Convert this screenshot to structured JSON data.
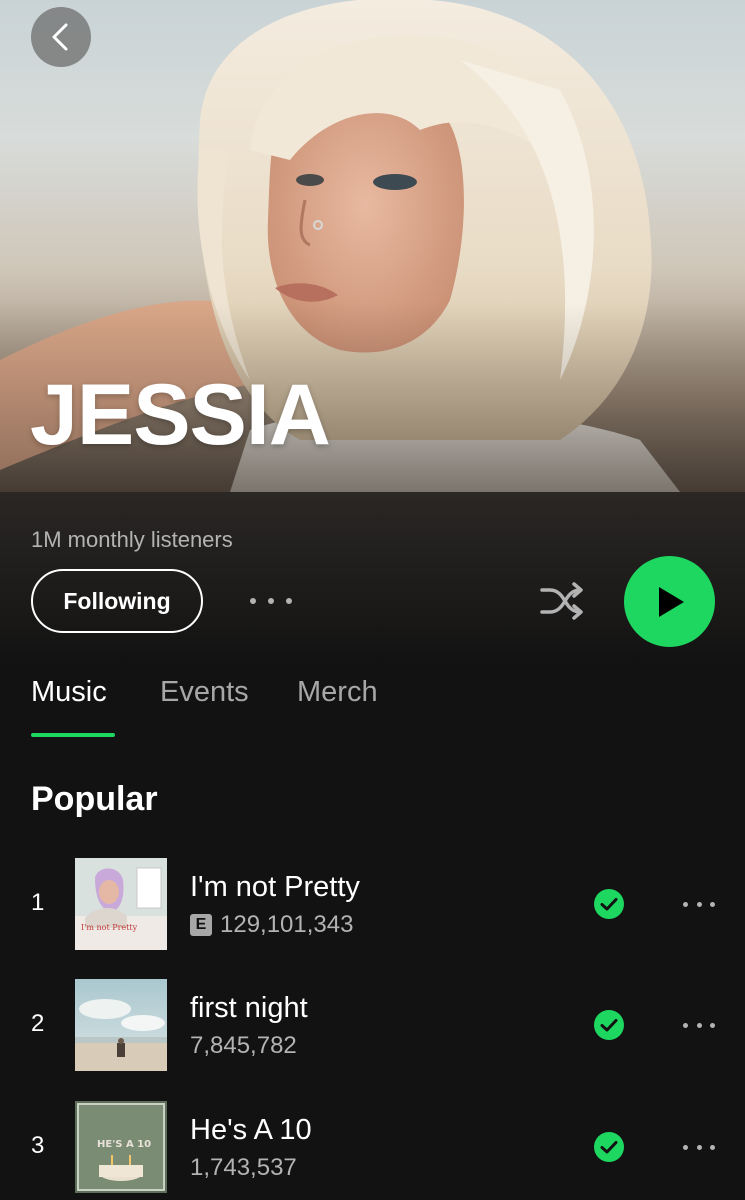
{
  "artist": {
    "name": "JESSIA",
    "monthly_listeners": "1M monthly listeners",
    "follow_label": "Following"
  },
  "tabs": [
    {
      "label": "Music",
      "active": true
    },
    {
      "label": "Events",
      "active": false
    },
    {
      "label": "Merch",
      "active": false
    }
  ],
  "popular": {
    "title": "Popular",
    "tracks": [
      {
        "rank": "1",
        "title": "I'm not Pretty",
        "plays": "129,101,343",
        "explicit": true,
        "explicit_label": "E",
        "saved": true
      },
      {
        "rank": "2",
        "title": "first night",
        "plays": "7,845,782",
        "explicit": false,
        "saved": true
      },
      {
        "rank": "3",
        "title": "He's A 10",
        "plays": "1,743,537",
        "explicit": false,
        "saved": true
      }
    ]
  },
  "cover_texts": {
    "track1_caption": "I'm not Pretty",
    "track3_caption": "HE'S A 10"
  },
  "colors": {
    "background": "#121212",
    "accent": "#1ed760",
    "secondary_text": "#b3b3b3"
  },
  "icons": {
    "back": "chevron-left-icon",
    "shuffle": "shuffle-icon",
    "play": "play-icon",
    "more": "more-horizontal-icon",
    "saved": "check-circle-icon"
  }
}
